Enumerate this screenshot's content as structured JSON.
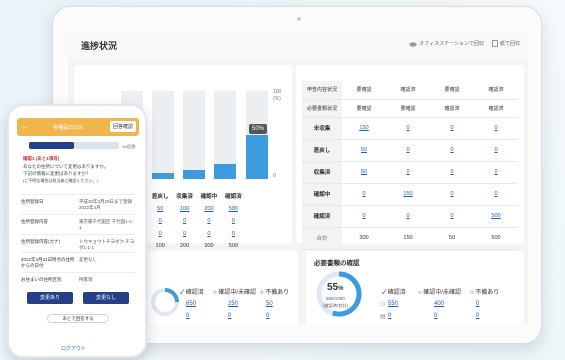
{
  "dashboard": {
    "title": "進捗状況",
    "header_links": [
      "オフィスステーションで回収",
      "紙で回収"
    ]
  },
  "bar_chart": {
    "y_axis": {
      "top": "100",
      "unit": "(%)",
      "bottom": "0"
    },
    "highlight_label": "50%"
  },
  "chart_table": {
    "headers": [
      "差戻し",
      "収集済",
      "確認中",
      "確認済"
    ],
    "rows": [
      [
        "50",
        "100",
        "200",
        "500"
      ],
      [
        "0",
        "0",
        "0",
        "0"
      ],
      [
        "0",
        "0",
        "0",
        "0"
      ],
      [
        "100",
        "200",
        "300",
        "500"
      ]
    ]
  },
  "right_table": {
    "head_rows": [
      {
        "label": "申告内容状況",
        "cells": [
          "要確認",
          "確認済",
          "要確認",
          "確認済"
        ]
      },
      {
        "label": "必要書類状況",
        "cells": [
          "要確認",
          "要確認",
          "確認済",
          "確認済"
        ]
      }
    ],
    "rows": [
      {
        "label": "未収集",
        "cells": [
          "150",
          "0",
          "0",
          "0"
        ]
      },
      {
        "label": "差戻し",
        "cells": [
          "50",
          "0",
          "0",
          "0"
        ]
      },
      {
        "label": "収集済",
        "cells": [
          "50",
          "0",
          "0",
          "0"
        ]
      },
      {
        "label": "確認中",
        "cells": [
          "0",
          "150",
          "0",
          "0"
        ]
      },
      {
        "label": "確認済",
        "cells": [
          "0",
          "0",
          "0",
          "500"
        ]
      },
      {
        "label": "合計",
        "cells": [
          "300",
          "150",
          "50",
          "500"
        ]
      }
    ]
  },
  "bottom_left": {
    "cols": [
      "確認済",
      "確認中/未確認",
      "不備あり"
    ],
    "row1": [
      "650",
      "250",
      "50"
    ],
    "row2": [
      "0",
      "0",
      "0"
    ]
  },
  "docs_panel": {
    "title": "必要書類の確認",
    "donut_pct": "55",
    "donut_unit": "%",
    "donut_count": "550",
    "donut_total": "/1000",
    "donut_caption": "(確認済/合計)",
    "cols": [
      "確認済",
      "確認中/未確認",
      "不備あり"
    ],
    "row1": [
      "550",
      "400",
      "0"
    ],
    "row2": [
      "0",
      "0",
      "0"
    ]
  },
  "phone": {
    "header_title": "各種届出(1/2)",
    "header_button": "回答確認",
    "progress_label": "1/2回答",
    "progress": 0.5,
    "note_title": "確認1 (あと1項目)",
    "note_lines": [
      "あなたの住所について変更はありますか。",
      "下記の情報に変更はありますか？",
      "(ご不明な場合は担当者に確認ください。)"
    ],
    "rows": [
      {
        "k": "住所登録日",
        "v": "平成30年3月20日まで登録 2022年4月"
      },
      {
        "k": "住所登録内容",
        "v": "東京都千代田区 千代田1-1-1"
      },
      {
        "k": "住所登録内容(カナ)",
        "v": "トウキョウトチヨダク チヨダ1-1-1"
      },
      {
        "k": "2022年3月31日時点の住所からの日付",
        "v": "変更なし"
      },
      {
        "k": "お住まいの住所区別",
        "v": "持家等"
      }
    ],
    "btn_change": "変更あり",
    "btn_nochange": "変更なし",
    "btn_later": "あとで回答する",
    "logout": "ログアウト"
  }
}
